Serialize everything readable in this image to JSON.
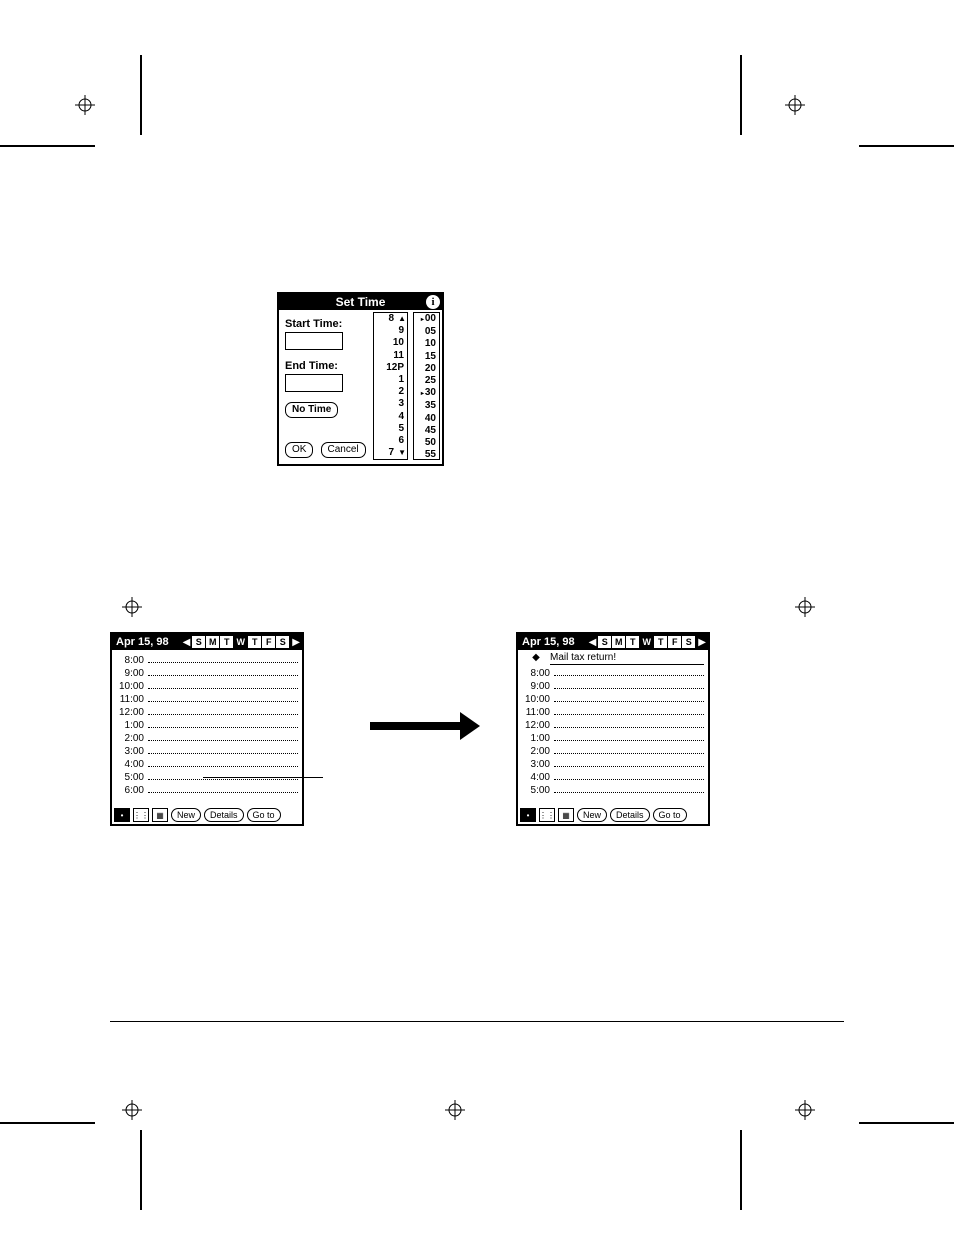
{
  "set_time": {
    "title": "Set Time",
    "start_label": "Start Time:",
    "end_label": "End Time:",
    "no_time_label": "No Time",
    "ok_label": "OK",
    "cancel_label": "Cancel",
    "hours": [
      "8",
      "9",
      "10",
      "11",
      "12P",
      "1",
      "2",
      "3",
      "4",
      "5",
      "6",
      "7"
    ],
    "minutes": [
      "00",
      "05",
      "10",
      "15",
      "20",
      "25",
      "30",
      "35",
      "40",
      "45",
      "50",
      "55"
    ],
    "minute_selected_a": "00",
    "minute_selected_b": "30"
  },
  "dayview": {
    "date": "Apr 15, 98",
    "days": [
      "S",
      "M",
      "T",
      "W",
      "T",
      "F",
      "S"
    ],
    "selected_day": "W",
    "times_left": [
      "8:00",
      "9:00",
      "10:00",
      "11:00",
      "12:00",
      "1:00",
      "2:00",
      "3:00",
      "4:00",
      "5:00",
      "6:00"
    ],
    "times_right": [
      "8:00",
      "9:00",
      "10:00",
      "11:00",
      "12:00",
      "1:00",
      "2:00",
      "3:00",
      "4:00",
      "5:00"
    ],
    "event_text": "Mail tax return!",
    "new_label": "New",
    "details_label": "Details",
    "goto_label": "Go to"
  }
}
